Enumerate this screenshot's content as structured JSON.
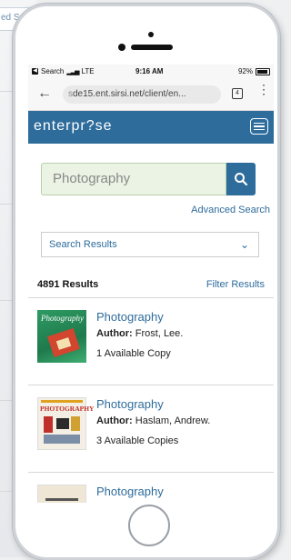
{
  "status_bar": {
    "carrier": "Search",
    "network": "LTE",
    "time": "9:16 AM",
    "battery": "92%"
  },
  "browser": {
    "url_prefix": "s",
    "url": "de15.ent.sirsi.net/client/en...",
    "tab_count": "4"
  },
  "app": {
    "logo": "enterpr?se",
    "accent": "#2e6c9c"
  },
  "search": {
    "value": "Photography",
    "advanced_label": "Advanced Search",
    "select_value": "Search Results"
  },
  "results": {
    "count_label": "4891 Results",
    "filter_label": "Filter Results",
    "items": [
      {
        "title": "Photography",
        "author_label": "Author:",
        "author": " Frost, Lee.",
        "availability": "1 Available Copy",
        "cover_text": "Photography"
      },
      {
        "title": "Photography",
        "author_label": "Author:",
        "author": " Haslam, Andrew.",
        "availability": "3 Available Copies",
        "cover_text": "PHOTOGRAPHY"
      },
      {
        "title": "Photography"
      }
    ]
  },
  "background": {
    "snippet": "ed Se"
  }
}
